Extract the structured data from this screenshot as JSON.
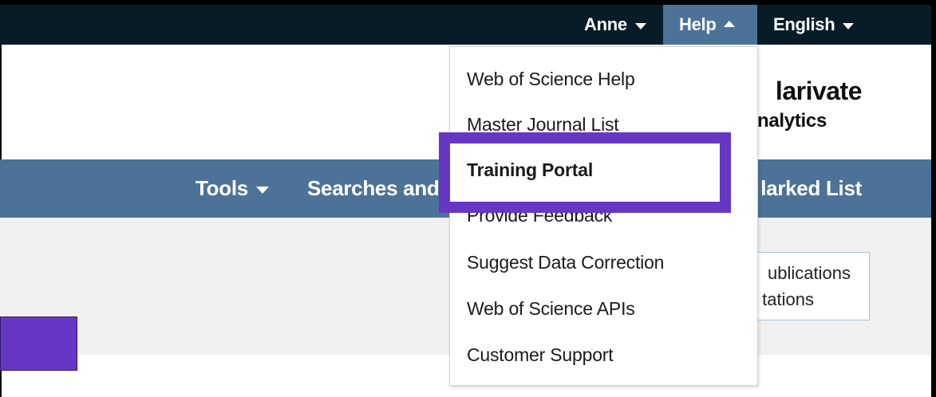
{
  "topbar": {
    "user_label": "Anne",
    "help_label": "Help",
    "language_label": "English"
  },
  "logo": {
    "name": "Clarivate",
    "name_visible": "larivate",
    "sub": "Analytics",
    "sub_visible": "nalytics"
  },
  "nav": {
    "tools_label": "Tools",
    "searches_label": "Searches and",
    "marked_label": "larked List"
  },
  "content": {
    "pub_line1": "ublications",
    "pub_line2": "tations"
  },
  "help_menu": {
    "items": [
      "Web of Science Help",
      "Master Journal List",
      "Training Portal",
      "Provide Feedback",
      "Suggest Data Correction",
      "Web of Science APIs",
      "Customer Support"
    ]
  },
  "colors": {
    "topbar_bg": "#071c27",
    "nav_bg": "#4d7297",
    "highlight": "#6637c4",
    "grey_band": "#f0f0f0"
  }
}
